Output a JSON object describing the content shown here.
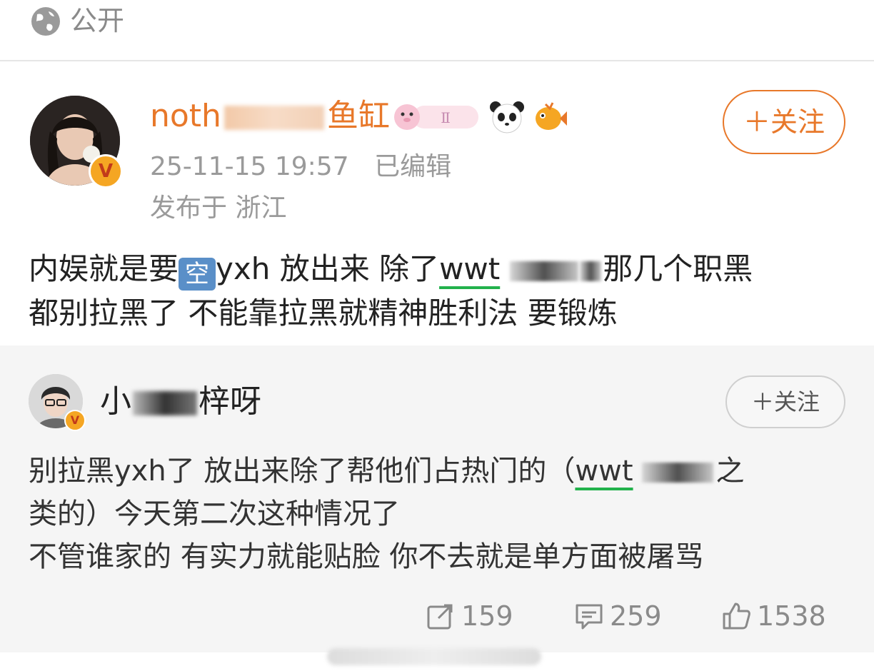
{
  "visibility": {
    "label": "公开",
    "icon": "globe-icon"
  },
  "post": {
    "author": {
      "name_prefix": "noth",
      "name_suffix": "鱼缸",
      "verified": true
    },
    "time": "25-11-15 19:57",
    "edited": "已编辑",
    "location": "发布于 浙江",
    "follow_label": "＋关注",
    "text": {
      "line1_a": "内娱就是要",
      "kong_badge": "空",
      "line1_b": "yxh 放出来 除了",
      "wwt": "wwt",
      "line1_c": "那几个职黑",
      "line2": "都别拉黑了 不能靠拉黑就精神胜利法 要锻炼"
    }
  },
  "repost": {
    "author": {
      "name_prefix": "小",
      "name_suffix": "梓呀",
      "verified": true
    },
    "follow_label": "＋关注",
    "text": {
      "line1_a": "别拉黑yxh了 放出来除了帮他们占热门的（",
      "wwt": "wwt",
      "line1_b": "之",
      "line2": "类的）今天第二次这种情况了",
      "line3": "不管谁家的 有实力就能贴脸 你不去就是单方面被屠骂"
    },
    "actions": {
      "reposts": "159",
      "comments": "259",
      "likes": "1538"
    }
  },
  "colors": {
    "accent": "#e8782a",
    "link_underline": "#22b24c",
    "meta_gray": "#9a9a9a"
  }
}
